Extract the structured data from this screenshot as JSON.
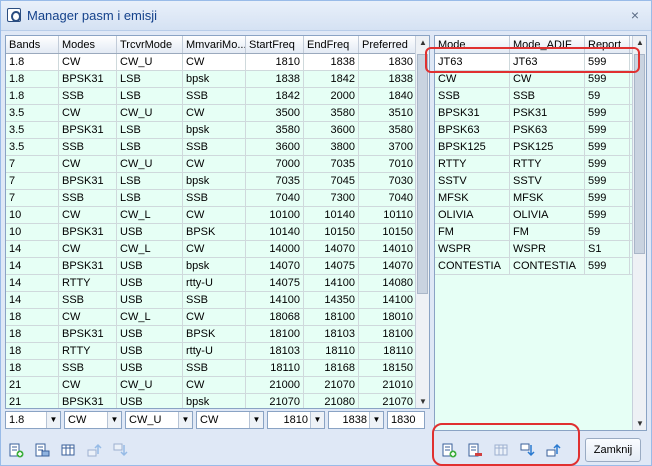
{
  "window": {
    "title": "Manager pasm i emisji",
    "close_glyph": "×"
  },
  "left_table": {
    "columns": [
      "Bands",
      "Modes",
      "TrcvrMode",
      "MmvariMo...",
      "StartFreq",
      "EndFreq",
      "Preferred"
    ],
    "rows": [
      [
        "1.8",
        "CW",
        "CW_U",
        "CW",
        "1810",
        "1838",
        "1830"
      ],
      [
        "1.8",
        "BPSK31",
        "LSB",
        "bpsk",
        "1838",
        "1842",
        "1838"
      ],
      [
        "1.8",
        "SSB",
        "LSB",
        "SSB",
        "1842",
        "2000",
        "1840"
      ],
      [
        "3.5",
        "CW",
        "CW_U",
        "CW",
        "3500",
        "3580",
        "3510"
      ],
      [
        "3.5",
        "BPSK31",
        "LSB",
        "bpsk",
        "3580",
        "3600",
        "3580"
      ],
      [
        "3.5",
        "SSB",
        "LSB",
        "SSB",
        "3600",
        "3800",
        "3700"
      ],
      [
        "7",
        "CW",
        "CW_U",
        "CW",
        "7000",
        "7035",
        "7010"
      ],
      [
        "7",
        "BPSK31",
        "LSB",
        "bpsk",
        "7035",
        "7045",
        "7030"
      ],
      [
        "7",
        "SSB",
        "LSB",
        "SSB",
        "7040",
        "7300",
        "7040"
      ],
      [
        "10",
        "CW",
        "CW_L",
        "CW",
        "10100",
        "10140",
        "10110"
      ],
      [
        "10",
        "BPSK31",
        "USB",
        "BPSK",
        "10140",
        "10150",
        "10150"
      ],
      [
        "14",
        "CW",
        "CW_L",
        "CW",
        "14000",
        "14070",
        "14010"
      ],
      [
        "14",
        "BPSK31",
        "USB",
        "bpsk",
        "14070",
        "14075",
        "14070"
      ],
      [
        "14",
        "RTTY",
        "USB",
        "rtty-U",
        "14075",
        "14100",
        "14080"
      ],
      [
        "14",
        "SSB",
        "USB",
        "SSB",
        "14100",
        "14350",
        "14100"
      ],
      [
        "18",
        "CW",
        "CW_L",
        "CW",
        "18068",
        "18100",
        "18010"
      ],
      [
        "18",
        "BPSK31",
        "USB",
        "BPSK",
        "18100",
        "18103",
        "18100"
      ],
      [
        "18",
        "RTTY",
        "USB",
        "rtty-U",
        "18103",
        "18110",
        "18110"
      ],
      [
        "18",
        "SSB",
        "USB",
        "SSB",
        "18110",
        "18168",
        "18150"
      ],
      [
        "21",
        "CW",
        "CW_U",
        "CW",
        "21000",
        "21070",
        "21010"
      ],
      [
        "21",
        "BPSK31",
        "USB",
        "bpsk",
        "21070",
        "21080",
        "21070"
      ]
    ],
    "editor": [
      "1.8",
      "CW",
      "CW_U",
      "CW",
      "1810",
      "1838",
      "1830"
    ]
  },
  "right_table": {
    "columns": [
      "Mode",
      "Mode_ADIF",
      "Report"
    ],
    "rows": [
      [
        "JT63",
        "JT63",
        "599"
      ],
      [
        "CW",
        "CW",
        "599"
      ],
      [
        "SSB",
        "SSB",
        "59"
      ],
      [
        "BPSK31",
        "PSK31",
        "599"
      ],
      [
        "BPSK63",
        "PSK63",
        "599"
      ],
      [
        "BPSK125",
        "PSK125",
        "599"
      ],
      [
        "RTTY",
        "RTTY",
        "599"
      ],
      [
        "SSTV",
        "SSTV",
        "599"
      ],
      [
        "MFSK",
        "MFSK",
        "599"
      ],
      [
        "OLIVIA",
        "OLIVIA",
        "599"
      ],
      [
        "FM",
        "FM",
        "59"
      ],
      [
        "WSPR",
        "WSPR",
        "S1"
      ],
      [
        "CONTESTIA",
        "CONTESTIA",
        "599"
      ]
    ]
  },
  "buttons": {
    "close_label": "Zamknij"
  },
  "icons": {
    "left_toolbar": [
      "add-record-icon",
      "edit-record-icon",
      "table-icon",
      "move-up-icon",
      "move-down-icon"
    ],
    "right_toolbar": [
      "add-record-icon",
      "delete-record-icon",
      "table-icon",
      "move-down-icon",
      "move-up-icon"
    ]
  },
  "colors": {
    "grid_bg": "#e6fff5",
    "annotation": "#e03030",
    "title_text": "#15428b"
  }
}
